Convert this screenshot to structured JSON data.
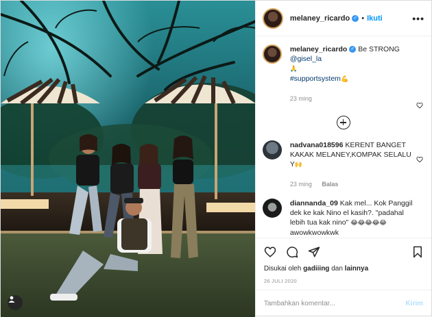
{
  "header": {
    "username": "melaney_ricardo",
    "separator": "•",
    "follow_label": "Ikuti",
    "more_label": "•••"
  },
  "caption": {
    "username": "melaney_ricardo",
    "text": "Be STRONG",
    "mention": "@gisel_la",
    "emoji": "🙏",
    "hashtag": "#supportsystem",
    "hashtag_emoji": "💪",
    "time": "23 ming"
  },
  "comments": [
    {
      "username": "nadvana018596",
      "text": "KERENT BANGET KAKAK MELANEY,KOMPAK SELALU Y",
      "emoji": "🙌",
      "time": "23 ming",
      "reply_label": "Balas"
    },
    {
      "username": "diannanda_09",
      "text": "Kak mel... Kok Panggil dek ke kak Nino el kasih?. \"padahal lebih tua kak nino\"",
      "emoji": "😂😂😂😂😂",
      "tail": "awowkwowkwk"
    }
  ],
  "actions": {
    "liked_by_prefix": "Disukai oleh",
    "liked_by_user": "gadiiing",
    "liked_by_joiner": "dan",
    "liked_by_others": "lainnya",
    "date": "26 JULI 2020"
  },
  "composer": {
    "placeholder": "Tambahkan komentar...",
    "send_label": "Kirim"
  },
  "colors": {
    "accent": "#0095f6",
    "verified": "#3897f0",
    "send_disabled": "#b2dffc",
    "photo_sky": "#1f7a82"
  }
}
